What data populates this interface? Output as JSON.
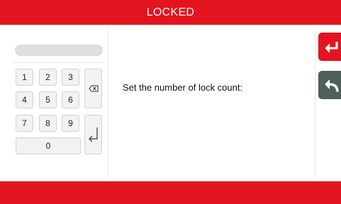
{
  "header": {
    "title": "LOCKED"
  },
  "main": {
    "prompt": "Set the number of lock count:"
  },
  "keypad": {
    "display_value": "",
    "keys": {
      "k1": "1",
      "k2": "2",
      "k3": "3",
      "k4": "4",
      "k5": "5",
      "k6": "6",
      "k7": "7",
      "k8": "8",
      "k9": "9",
      "k0": "0"
    },
    "backspace_icon": "backspace-icon",
    "enter_icon": "enter-icon"
  },
  "side_buttons": {
    "enter_icon": "enter-icon",
    "back_icon": "back-arrow-icon"
  },
  "colors": {
    "brand_red": "#e3141f",
    "back_button": "#4f5f5c",
    "key_bg": "#f2f2f2"
  }
}
